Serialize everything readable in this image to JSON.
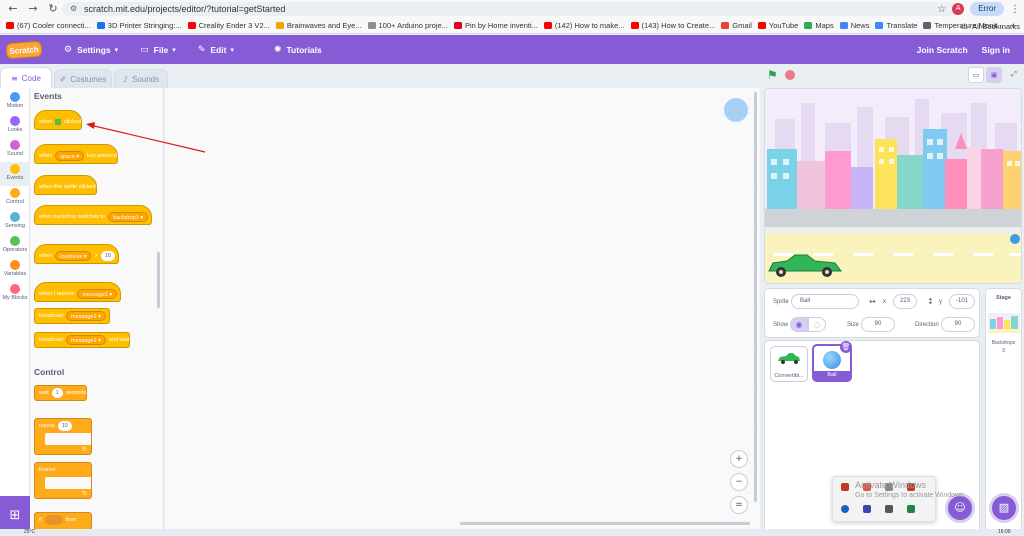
{
  "browser": {
    "url": "scratch.mit.edu/projects/editor/?tutorial=getStarted",
    "profile_initial": "A",
    "error_button": "Error",
    "bookmarks": [
      {
        "label": "(67) Cooler connecti...",
        "color": "#ff0000"
      },
      {
        "label": "3D Printer Stringing:...",
        "color": "#1a73e8"
      },
      {
        "label": "Creality Ender 3 V2...",
        "color": "#ff0000"
      },
      {
        "label": "Brainwaves and Eye...",
        "color": "#f4a300"
      },
      {
        "label": "100+ Arduino proje...",
        "color": "#8e8e8e"
      },
      {
        "label": "Pin by Home inventi...",
        "color": "#e60023"
      },
      {
        "label": "(142) How to make...",
        "color": "#ff0000"
      },
      {
        "label": "(143) How to Create...",
        "color": "#ff0000"
      },
      {
        "label": "Gmail",
        "color": "#ea4335"
      },
      {
        "label": "YouTube",
        "color": "#ff0000"
      },
      {
        "label": "Maps",
        "color": "#34a853"
      },
      {
        "label": "News",
        "color": "#4285f4"
      },
      {
        "label": "Translate",
        "color": "#4285f4"
      },
      {
        "label": "Temperature Monit...",
        "color": "#5f6368"
      }
    ],
    "bookmarks_more": "»",
    "all_bookmarks": "All Bookmarks"
  },
  "menubar": {
    "logo": "Scratch",
    "settings": "Settings",
    "file": "File",
    "edit": "Edit",
    "tutorials": "Tutorials",
    "join": "Join Scratch",
    "signin": "Sign in"
  },
  "tabs": {
    "code": "Code",
    "costumes": "Costumes",
    "sounds": "Sounds"
  },
  "categories": [
    {
      "label": "Motion",
      "color": "#4c97ff"
    },
    {
      "label": "Looks",
      "color": "#9966ff"
    },
    {
      "label": "Sound",
      "color": "#cf63cf"
    },
    {
      "label": "Events",
      "color": "#ffbf00"
    },
    {
      "label": "Control",
      "color": "#ffab19"
    },
    {
      "label": "Sensing",
      "color": "#5cb1d6"
    },
    {
      "label": "Operators",
      "color": "#59c059"
    },
    {
      "label": "Variables",
      "color": "#ff8c1a"
    },
    {
      "label": "My Blocks",
      "color": "#ff6680"
    }
  ],
  "palette": {
    "events_title": "Events",
    "when_flag": {
      "a": "when",
      "b": "clicked"
    },
    "when_key": {
      "a": "when",
      "key": "space",
      "b": "key pressed"
    },
    "when_sprite_clicked": "when this sprite clicked",
    "when_backdrop": {
      "a": "when backdrop switches to",
      "b": "backdrop1"
    },
    "when_loudness": {
      "a": "when",
      "b": "loudness",
      "c": ">",
      "d": "10"
    },
    "when_receive": {
      "a": "when I receive",
      "b": "message1"
    },
    "broadcast": {
      "a": "broadcast",
      "b": "message1"
    },
    "broadcast_wait": {
      "a": "broadcast",
      "b": "message1",
      "c": "and wait"
    },
    "control_title": "Control",
    "wait": {
      "a": "wait",
      "b": "1",
      "c": "seconds"
    },
    "repeat": {
      "a": "repeat",
      "b": "10"
    },
    "forever": "forever",
    "if_then": {
      "a": "if",
      "b": "then"
    }
  },
  "sprite_info": {
    "sprite_label": "Sprite",
    "sprite_name": "Ball",
    "x_label": "x",
    "x_value": "223",
    "y_label": "y",
    "y_value": "-101",
    "show_label": "Show",
    "size_label": "Size",
    "size_value": "90",
    "direction_label": "Direction",
    "direction_value": "90"
  },
  "sprites": [
    {
      "name": "Convertibl..."
    },
    {
      "name": "Ball"
    }
  ],
  "stage_pane": {
    "title": "Stage",
    "backdrops_label": "Backdrops",
    "backdrops_count": "3"
  },
  "watermark": {
    "line1": "Activate Windows",
    "line2": "Go to Settings to activate Windows."
  },
  "taskbar": {
    "temp": "25°C",
    "clock": "16:09"
  }
}
